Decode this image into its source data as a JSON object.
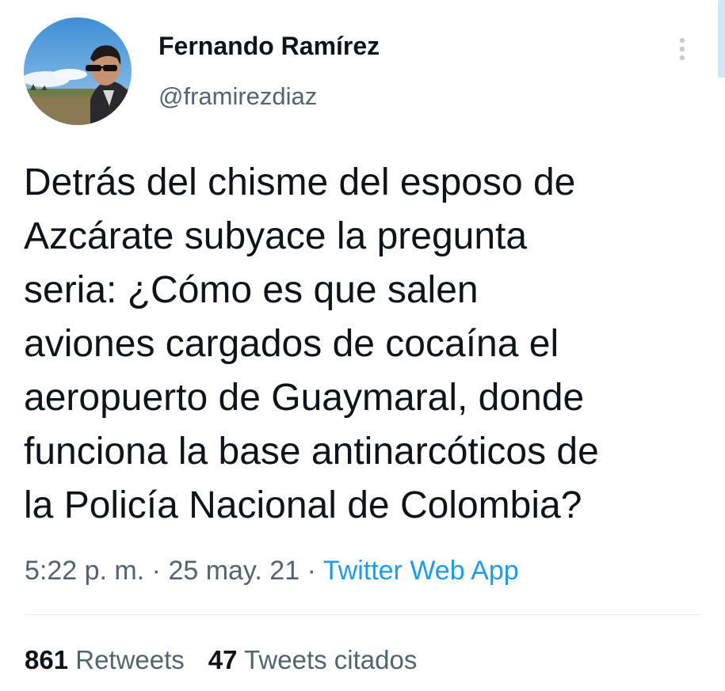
{
  "author": {
    "name": "Fernando Ramírez",
    "handle": "@framirezdiaz"
  },
  "tweet": {
    "lines": [
      "Detrás del chisme del esposo de",
      "Azcárate subyace la pregunta",
      "seria: ¿Cómo es que salen",
      "aviones cargados de cocaína el",
      "aeropuerto de Guaymaral, donde",
      "funciona la base antinarcóticos de",
      "la Policía Nacional de Colombia?"
    ]
  },
  "meta": {
    "time": "5:22 p. m.",
    "separator": "·",
    "date": "25 may. 21",
    "source": "Twitter Web App"
  },
  "stats": {
    "retweets_count": "861",
    "retweets_label": "Retweets",
    "quotes_count": "47",
    "quotes_label": "Tweets citados"
  },
  "icons": {
    "more": "more-vertical-icon",
    "avatar": "profile-photo"
  },
  "colors": {
    "text": "#0f1419",
    "secondary": "#536471",
    "link": "#1d9bf0",
    "divider": "#e6ecf0"
  }
}
